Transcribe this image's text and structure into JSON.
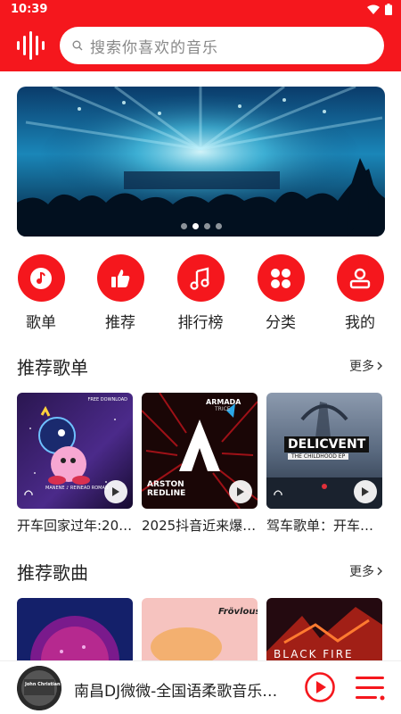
{
  "status": {
    "time": "10:39"
  },
  "search": {
    "placeholder": "搜索你喜欢的音乐"
  },
  "banner": {
    "dot_count": 4,
    "active_dot": 1
  },
  "nav": [
    {
      "label": "歌单",
      "icon": "music-note-icon"
    },
    {
      "label": "推荐",
      "icon": "thumbs-up-icon"
    },
    {
      "label": "排行榜",
      "icon": "music-list-icon"
    },
    {
      "label": "分类",
      "icon": "category-icon"
    },
    {
      "label": "我的",
      "icon": "user-icon"
    }
  ],
  "playlists_section": {
    "title": "推荐歌单",
    "more_label": "更多",
    "items": [
      {
        "caption": "开车回家过年:20…",
        "cover_text_top": "FREE DOWNLOAD",
        "cover_text_bottom": "MANENE ♪ REINEAD ROMAN"
      },
      {
        "caption": "2025抖音近来爆…",
        "cover_text_top": "ARMADA",
        "cover_text_sub": "TRICE",
        "cover_text_bottom": "ARSTON",
        "cover_text_bottom2": "REDLINE"
      },
      {
        "caption": "驾车歌单：开车…",
        "cover_text_top": "DELICVENT",
        "cover_text_sub": "THE CHILDHOOD EP"
      }
    ]
  },
  "songs_section": {
    "title": "推荐歌曲",
    "more_label": "更多",
    "items": [
      {
        "cover_text": ""
      },
      {
        "cover_text": "Frövlous"
      },
      {
        "cover_text": "BLACK FIRE"
      }
    ]
  },
  "player": {
    "song_title": "南昌DJ微微-全国语柔歌音乐…",
    "disc_text": "John Christian"
  },
  "colors": {
    "accent": "#f5171d"
  }
}
